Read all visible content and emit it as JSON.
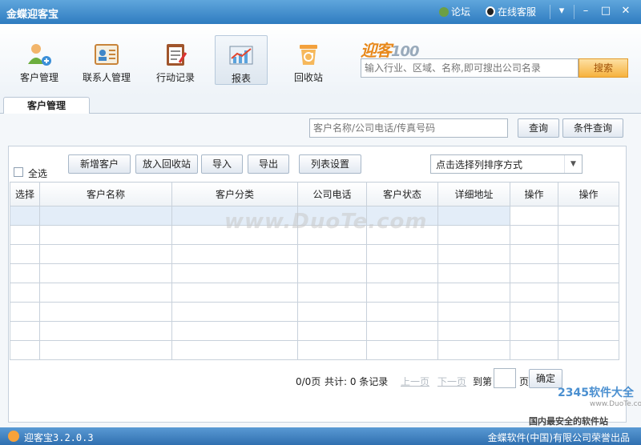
{
  "window": {
    "title": "金蝶迎客宝",
    "links": {
      "forum": "论坛",
      "service": "在线客服"
    },
    "buttons": {
      "menu": "▾",
      "minimize": "–",
      "maximize": "□",
      "close": "✕"
    }
  },
  "toolbar": {
    "items": [
      {
        "label": "客户管理",
        "icon": "customers-icon"
      },
      {
        "label": "联系人管理",
        "icon": "contact-card-icon"
      },
      {
        "label": "行动记录",
        "icon": "clipboard-icon"
      },
      {
        "label": "报表",
        "icon": "chart-icon",
        "active": true
      },
      {
        "label": "回收站",
        "icon": "recycle-bin-icon"
      }
    ]
  },
  "brand": {
    "logo_text": "迎客",
    "logo_num": "100"
  },
  "top_search": {
    "placeholder": "输入行业、区域、名称,即可搜出公司名录",
    "button": "搜索"
  },
  "tabs": [
    {
      "label": "客户管理"
    }
  ],
  "query": {
    "placeholder": "客户名称/公司电话/传真号码",
    "search_button": "查询",
    "advanced_button": "条件查询"
  },
  "actions": {
    "add": "新增客户",
    "recycle": "放入回收站",
    "import": "导入",
    "export": "导出",
    "columns": "列表设置",
    "select_all": "全选",
    "sort_placeholder": "点击选择列排序方式"
  },
  "table": {
    "columns": [
      "选择",
      "客户名称",
      "客户分类",
      "公司电话",
      "客户状态",
      "详细地址",
      "操作",
      "操作"
    ],
    "rows": 8
  },
  "pager": {
    "page_info": "0/0页",
    "total": "共计: 0 条记录",
    "prev": "上一页",
    "next": "下一页",
    "goto": "到第",
    "page_suffix": "页",
    "confirm": "确定"
  },
  "watermark": "www.DuoTe.com",
  "stamp": {
    "brand": "2345软件大全",
    "url": "www.DuoTe.com",
    "slogan": "国内最安全的软件站"
  },
  "status": {
    "version": "迎客宝3.2.0.3",
    "company": "金蝶软件(中国)有限公司荣誉出品"
  },
  "colors": {
    "title_bar": "#3a86c8",
    "accent_orange": "#f6b23e",
    "selected_row": "#e3edf8"
  }
}
